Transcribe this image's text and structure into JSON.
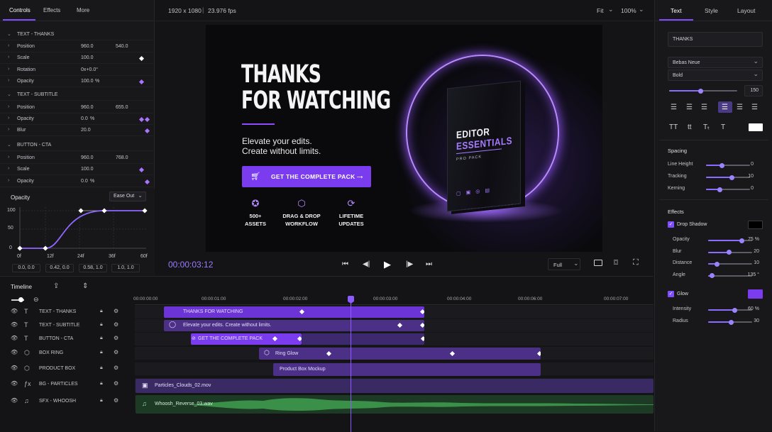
{
  "left_tabs": [
    "Controls",
    "Effects",
    "More"
  ],
  "sections": [
    {
      "title": "TEXT - THANKS",
      "props": [
        {
          "name": "Position",
          "v1": "960.0",
          "v2": "540.0",
          "kf": ""
        },
        {
          "name": "Scale",
          "v1": "100.0",
          "v2": "",
          "kf": "w"
        },
        {
          "name": "Rotation",
          "v1": "0x+0.0°",
          "v2": "",
          "kf": ""
        },
        {
          "name": "Opacity",
          "v1": "100.0",
          "unit": "%",
          "v2": "",
          "kf": "p"
        }
      ]
    },
    {
      "title": "TEXT - SUBTITLE",
      "props": [
        {
          "name": "Position",
          "v1": "960.0",
          "v2": "655.0",
          "kf": ""
        },
        {
          "name": "Opacity",
          "v1": "0.0",
          "unit": "%",
          "v2": "",
          "kf": "pp"
        },
        {
          "name": "Blur",
          "v1": "20.0",
          "v2": "",
          "kf": "p"
        }
      ]
    },
    {
      "title": "BUTTON - CTA",
      "props": [
        {
          "name": "Position",
          "v1": "960.0",
          "v2": "768.0",
          "kf": ""
        },
        {
          "name": "Scale",
          "v1": "100.0",
          "v2": "",
          "kf": "p"
        },
        {
          "name": "Opacity",
          "v1": "0.0",
          "unit": "%",
          "v2": "",
          "kf": "p"
        }
      ]
    }
  ],
  "graph": {
    "title": "Opacity",
    "ease": "Ease Out",
    "y_ticks": [
      "100",
      "50",
      "0"
    ],
    "x_ticks": [
      "0f",
      "12f",
      "24f",
      "36f",
      "60f"
    ],
    "handles": [
      "0.0, 0.0",
      "0.42, 0.0",
      "0.58, 1.0",
      "1.0, 1.0"
    ]
  },
  "viewer": {
    "resolution": "1920 x 1080",
    "fps": "23.976 fps",
    "fit": "Fit",
    "zoom": "100%",
    "timecode": "00:00:03:12",
    "quality": "Full"
  },
  "preview": {
    "headline_1": "THANKS",
    "headline_2": "FOR WATCHING",
    "sub_1": "Elevate your edits.",
    "sub_2": "Create without limits.",
    "cta": "GET THE COMPLETE PACK",
    "features": [
      {
        "l1": "500+",
        "l2": "ASSETS"
      },
      {
        "l1": "DRAG & DROP",
        "l2": "WORKFLOW"
      },
      {
        "l1": "LIFETIME",
        "l2": "UPDATES"
      }
    ],
    "box_title_1": "EDITOR",
    "box_title_2": "ESSENTIALS",
    "box_sub": "PRO PACK"
  },
  "timeline": {
    "title": "Timeline",
    "ruler": [
      "00:00:00:00",
      "00:00:01:00",
      "00:00:02:00",
      "00:00:03:00",
      "00:00:04:00",
      "00:00:06:00",
      "00:00:07:00"
    ],
    "layers": [
      {
        "name": "TEXT - THANKS",
        "type": "T"
      },
      {
        "name": "TEXT - SUBTITLE",
        "type": "T"
      },
      {
        "name": "BUTTON - CTA",
        "type": "T"
      },
      {
        "name": "BOX RING",
        "type": "cube"
      },
      {
        "name": "PRODUCT BOX",
        "type": "cube"
      },
      {
        "name": "BG - PARTICLES",
        "type": "fx"
      },
      {
        "name": "SFX - WHOOSH",
        "type": "note"
      }
    ],
    "clips": [
      "THANKS FOR WATCHING",
      "Elevate your edits. Create without limits.",
      "GET THE COMPLETE PACK",
      "Ring Glow",
      "Product Box Mockup",
      "Particles_Clouds_02.mov",
      "Whoosh_Reverse_03.wav"
    ]
  },
  "right": {
    "tabs": [
      "Text",
      "Style",
      "Layout"
    ],
    "text_value": "THANKS",
    "font": "Bebas Neue",
    "weight": "Bold",
    "size": "150",
    "spacing_title": "Spacing",
    "spacing": [
      {
        "name": "Line Height",
        "value": "0",
        "level": 0.35
      },
      {
        "name": "Tracking",
        "value": "10",
        "level": 0.58
      },
      {
        "name": "Kerning",
        "value": "0",
        "level": 0.3
      }
    ],
    "effects_title": "Effects",
    "shadow_label": "Drop Shadow",
    "shadow_color": "#000000",
    "shadow": [
      {
        "name": "Opacity",
        "value": "75",
        "unit": "%",
        "level": 0.75
      },
      {
        "name": "Blur",
        "value": "20",
        "unit": "",
        "level": 0.46
      },
      {
        "name": "Distance",
        "value": "10",
        "unit": "",
        "level": 0.2
      },
      {
        "name": "Angle",
        "value": "135",
        "unit": "°",
        "level": 0.08
      }
    ],
    "glow_label": "Glow",
    "glow_color": "#7b3cf0",
    "glow": [
      {
        "name": "Intensity",
        "value": "60",
        "unit": "%",
        "level": 0.6
      },
      {
        "name": "Radius",
        "value": "30",
        "unit": "",
        "level": 0.52
      }
    ]
  }
}
